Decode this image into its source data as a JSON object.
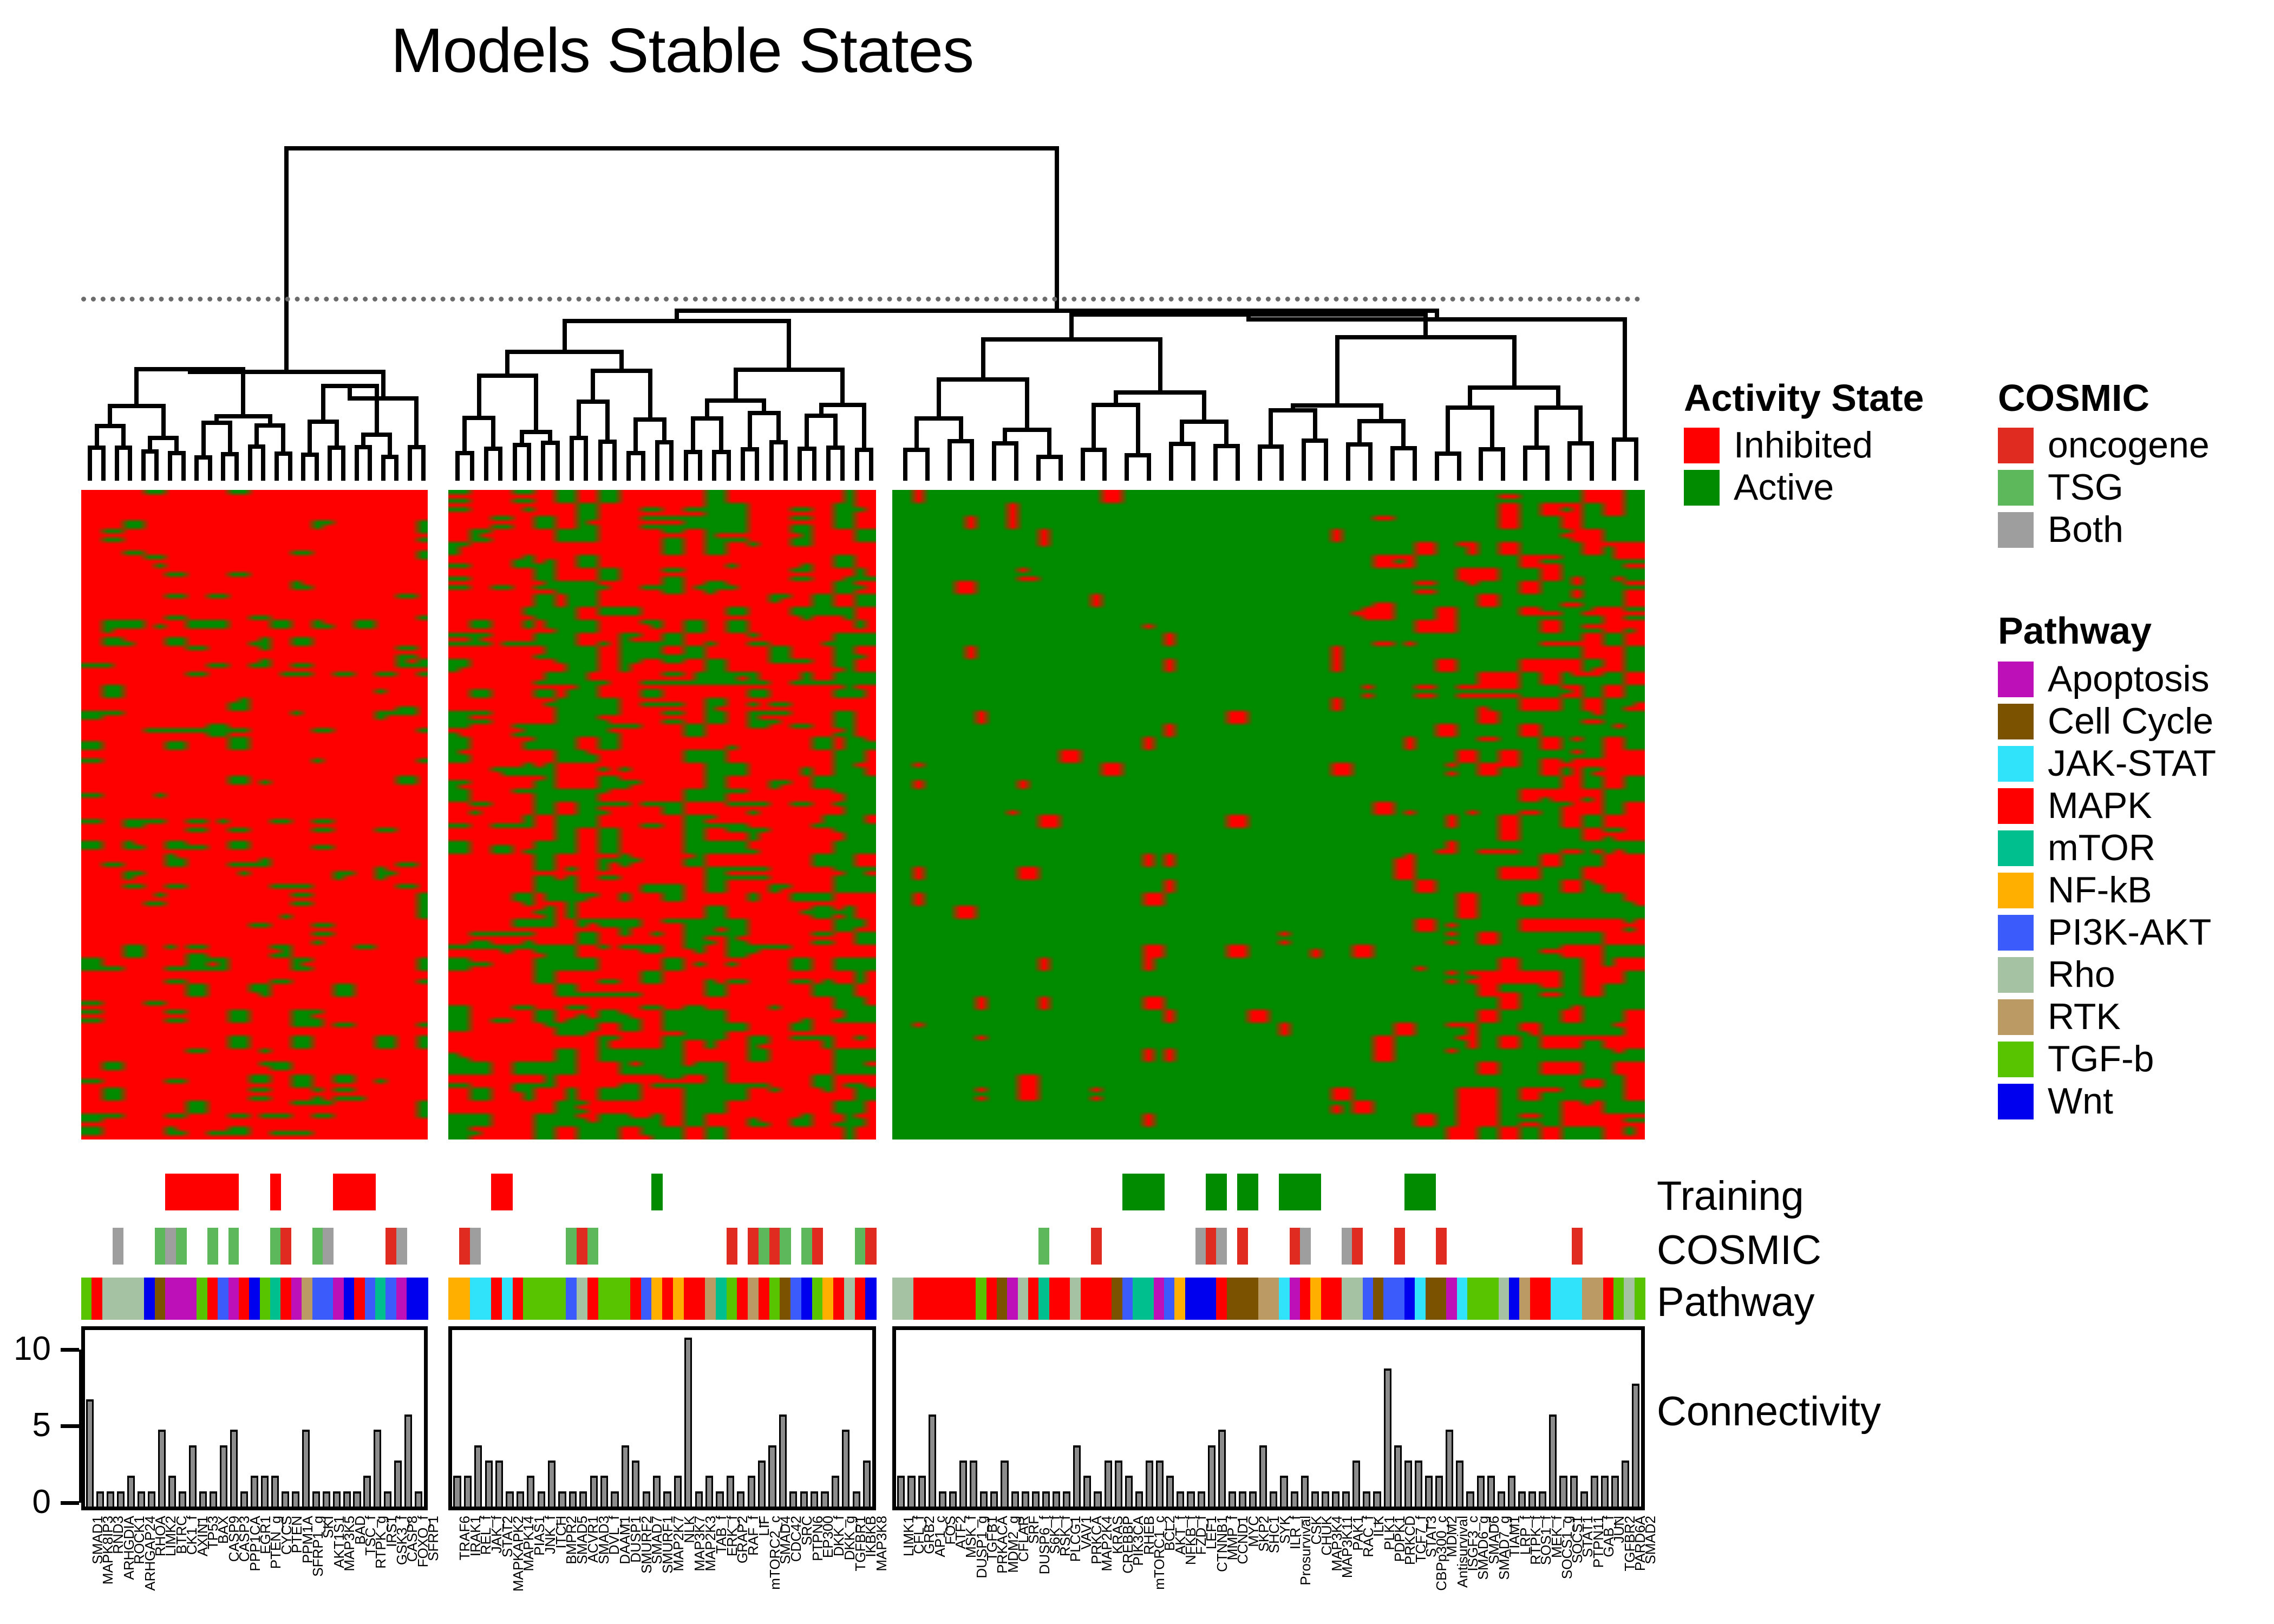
{
  "title": "Models Stable States",
  "row_titles": {
    "training": "Training",
    "cosmic": "COSMIC",
    "pathway": "Pathway",
    "connectivity": "Connectivity"
  },
  "legends": {
    "activity_state": {
      "title": "Activity State",
      "items": [
        {
          "label": "Inhibited",
          "color": "#FF0000"
        },
        {
          "label": "Active",
          "color": "#008B00"
        }
      ]
    },
    "cosmic": {
      "title": "COSMIC",
      "items": [
        {
          "label": "oncogene",
          "color": "#E02B20"
        },
        {
          "label": "TSG",
          "color": "#5DB85C"
        },
        {
          "label": "Both",
          "color": "#9E9E9E"
        }
      ]
    },
    "pathway": {
      "title": "Pathway",
      "items": [
        {
          "label": "Apoptosis",
          "color": "#BD10B8"
        },
        {
          "label": "Cell Cycle",
          "color": "#7A5200"
        },
        {
          "label": "JAK-STAT",
          "color": "#31E2FB"
        },
        {
          "label": "MAPK",
          "color": "#FF0000"
        },
        {
          "label": "mTOR",
          "color": "#00BF8F"
        },
        {
          "label": "NF-kB",
          "color": "#FFAF00"
        },
        {
          "label": "PI3K-AKT",
          "color": "#3B5BFB"
        },
        {
          "label": "Rho",
          "color": "#A5C3A2"
        },
        {
          "label": "RTK",
          "color": "#BC9A63"
        },
        {
          "label": "TGF-b",
          "color": "#58C400"
        },
        {
          "label": "Wnt",
          "color": "#0000EE"
        }
      ]
    }
  },
  "chart_data": {
    "type": "heatmap",
    "title": "Models Stable States",
    "description": "Clustered heatmap of boolean model stable states (Inhibited / Active) over network nodes, with column dendrogram, Training / COSMIC / Pathway annotation tracks and a Connectivity bar chart.",
    "value_encoding": {
      "Inhibited": "#FF0000",
      "Active": "#008B00"
    },
    "n_clusters": 3,
    "connectivity_axis": {
      "ylabel": "Connectivity",
      "ticks": [
        0,
        5,
        10
      ],
      "ylim": [
        0,
        11.5
      ]
    },
    "clusters": [
      {
        "name": "cluster-1",
        "dominant_state": "Inhibited",
        "genes": [
          "SMAD1",
          "MAPK8IP3",
          "RND3",
          "ARHGDIA",
          "ROCK1",
          "ARHGAP24",
          "RHOA",
          "LIMK2",
          "BTRC",
          "CK1_f",
          "AXIN1",
          "TP53",
          "BAX",
          "CASP9",
          "CASP3",
          "PPP1CA",
          "EGR1",
          "PTEN_g",
          "CYCS",
          "PTEN",
          "PPM1A",
          "SFRP1_g",
          "SKI",
          "AKT1S1",
          "MAP3K5",
          "BAD",
          "TSC_f",
          "RTPK_g",
          "IRS1",
          "GSK3_f",
          "CASP8",
          "FOXO_f",
          "SFRP1"
        ],
        "training": [
          0,
          0,
          0,
          0,
          0,
          0,
          0,
          0,
          1,
          1,
          1,
          1,
          1,
          1,
          1,
          0,
          0,
          0,
          1,
          0,
          0,
          0,
          0,
          0,
          1,
          1,
          1,
          1,
          0,
          0,
          0,
          0,
          0
        ],
        "cosmic": [
          "",
          "",
          "",
          "Both",
          "",
          "",
          "",
          "TSG",
          "Both",
          "TSG",
          "",
          "",
          "TSG",
          "",
          "TSG",
          "",
          "",
          "",
          "TSG",
          "oncogene",
          "",
          "",
          "TSG",
          "Both",
          "",
          "",
          "",
          "",
          "",
          "oncogene",
          "Both",
          "",
          ""
        ],
        "pathway": [
          "TGF-b",
          "MAPK",
          "Rho",
          "Rho",
          "Rho",
          "Rho",
          "Wnt",
          "Cell Cycle",
          "Apoptosis",
          "Apoptosis",
          "Apoptosis",
          "TGF-b",
          "MAPK",
          "PI3K-AKT",
          "Apoptosis",
          "MAPK",
          "Wnt",
          "TGF-b",
          "mTOR",
          "MAPK",
          "Apoptosis",
          "RTK",
          "PI3K-AKT",
          "PI3K-AKT",
          "Apoptosis",
          "Wnt",
          "MAPK",
          "PI3K-AKT",
          "mTOR",
          "PI3K-AKT",
          "Apoptosis",
          "Wnt",
          "Wnt"
        ],
        "connectivity": [
          7,
          1,
          1,
          1,
          2,
          1,
          1,
          5,
          2,
          1,
          4,
          1,
          1,
          4,
          5,
          1,
          2,
          2,
          2,
          1,
          1,
          5,
          1,
          1,
          1,
          1,
          1,
          2,
          5,
          1,
          3,
          6,
          1,
          3,
          1
        ]
      },
      {
        "name": "cluster-2",
        "dominant_state": "Mixed",
        "genes": [
          "TRAF6",
          "IRAK1",
          "REL_f",
          "JAK_f",
          "STAT2",
          "MAPKAPK2",
          "MAPK14",
          "PIAS1",
          "JNK_f",
          "ITCH",
          "BMPR2",
          "SMAD5",
          "ACVR1",
          "SMAD3",
          "DVL_f",
          "DAAM1",
          "DUSP1",
          "SMURF2",
          "SMAD7",
          "SMURF1",
          "MAP2K7",
          "NLK",
          "MAP3K7",
          "MAP2K3",
          "TAB_f",
          "ERK_f",
          "GRAP2",
          "RAF_f",
          "LIF",
          "mTORC2_c",
          "SMAD4",
          "CDC42",
          "SRC",
          "PTPN6",
          "EP300",
          "DKK_f",
          "DKK_g",
          "TGFBR1",
          "IKBKB",
          "MAP3K8"
        ],
        "training": [
          0,
          0,
          0,
          0,
          1,
          1,
          0,
          0,
          0,
          0,
          0,
          0,
          0,
          0,
          0,
          0,
          0,
          0,
          0,
          1,
          0,
          0,
          0,
          0,
          0,
          0,
          0,
          0,
          0,
          0,
          0,
          0,
          0,
          0,
          0,
          0,
          0,
          0,
          0,
          0
        ],
        "cosmic": [
          "",
          "oncogene",
          "Both",
          "",
          "",
          "",
          "",
          "",
          "",
          "",
          "",
          "TSG",
          "oncogene",
          "TSG",
          "",
          "",
          "",
          "",
          "",
          "",
          "",
          "",
          "",
          "",
          "",
          "",
          "oncogene",
          "",
          "oncogene",
          "TSG",
          "oncogene",
          "TSG",
          "",
          "TSG",
          "oncogene",
          "",
          "",
          "",
          "TSG",
          "oncogene"
        ],
        "pathway": [
          "NF-kB",
          "NF-kB",
          "JAK-STAT",
          "JAK-STAT",
          "MAPK",
          "JAK-STAT",
          "MAPK",
          "TGF-b",
          "TGF-b",
          "TGF-b",
          "TGF-b",
          "PI3K-AKT",
          "Rho",
          "MAPK",
          "TGF-b",
          "TGF-b",
          "TGF-b",
          "MAPK",
          "PI3K-AKT",
          "NF-kB",
          "MAPK",
          "NF-kB",
          "MAPK",
          "MAPK",
          "RTK",
          "mTOR",
          "TGF-b",
          "MAPK",
          "RTK",
          "MAPK",
          "TGF-b",
          "Cell Cycle",
          "PI3K-AKT",
          "Wnt",
          "TGF-b",
          "NF-kB",
          "MAPK",
          "Rho",
          "MAPK",
          "Wnt"
        ],
        "connectivity": [
          2,
          2,
          4,
          3,
          3,
          1,
          1,
          2,
          1,
          3,
          1,
          1,
          1,
          2,
          2,
          1,
          4,
          3,
          1,
          2,
          1,
          2,
          11,
          1,
          2,
          1,
          2,
          1,
          2,
          3,
          4,
          6,
          1,
          1,
          1,
          1,
          2,
          5,
          1,
          3,
          2,
          2,
          10,
          3,
          2,
          1,
          2,
          4,
          5,
          2,
          2,
          2,
          1,
          1,
          2,
          1,
          1,
          1
        ]
      },
      {
        "name": "cluster-3",
        "dominant_state": "Active",
        "genes": [
          "LIMK1",
          "CFL_f",
          "GRB2",
          "AP1_c",
          "FOS",
          "ATF2",
          "MSK_f",
          "DUSP1_g",
          "TGFB1",
          "PRKACA",
          "MDM2_g",
          "CFLAR",
          "SRF",
          "DUSP6_f",
          "S6K_f",
          "RSK_f",
          "PLCG1",
          "VAV1",
          "PRKCA",
          "MAP2K4",
          "KRAS",
          "CREBBP",
          "PIK3CA",
          "RHEB",
          "mTORC1_c",
          "BCL2",
          "AKT_f",
          "NFKB_f",
          "FZD_f",
          "LEF1",
          "CTNNB1",
          "MMP_f",
          "CCND1",
          "MYC",
          "SKP2",
          "SHC1",
          "SYK",
          "ILR_f",
          "Prosurvival",
          "CSK",
          "CHUK",
          "MAP3K4",
          "MAP3K11",
          "PAK1",
          "RAC_f",
          "ILK",
          "PLK1",
          "PDPK1",
          "PRKCD",
          "TCF7_f",
          "STAT3",
          "CBPp300_c",
          "MDM2",
          "Antisurvival",
          "ISGF3_c",
          "SMAD6_g",
          "SMAD6",
          "SMAD7_g",
          "TIAM1",
          "LRP_f",
          "RTPK_f",
          "SOS1_f",
          "MEK_f",
          "SOCS1_g",
          "SOCS1",
          "STAT1",
          "PTPN11",
          "GAB_f",
          "JUN",
          "TGFBR2",
          "PARD6A",
          "SMAD2"
        ],
        "training": [
          0,
          0,
          0,
          0,
          0,
          0,
          0,
          0,
          0,
          0,
          0,
          0,
          0,
          0,
          0,
          0,
          0,
          0,
          0,
          0,
          0,
          0,
          1,
          1,
          1,
          1,
          0,
          0,
          0,
          0,
          1,
          1,
          0,
          1,
          1,
          0,
          0,
          1,
          1,
          1,
          1,
          0,
          0,
          0,
          0,
          0,
          0,
          0,
          0,
          1,
          1,
          1,
          0,
          0,
          0,
          0,
          0,
          0,
          0,
          0,
          0,
          0,
          0,
          0,
          0,
          0,
          0,
          0,
          0,
          0,
          0,
          0
        ],
        "cosmic": [
          "",
          "",
          "",
          "",
          "",
          "",
          "",
          "",
          "",
          "",
          "",
          "",
          "",
          "",
          "TSG",
          "",
          "",
          "",
          "",
          "oncogene",
          "",
          "",
          "",
          "",
          "",
          "",
          "",
          "",
          "",
          "Both",
          "oncogene",
          "Both",
          "",
          "oncogene",
          "",
          "",
          "",
          "",
          "oncogene",
          "Both",
          "",
          "",
          "",
          "Both",
          "oncogene",
          "",
          "",
          "",
          "oncogene",
          "",
          "",
          "",
          "oncogene",
          "",
          "",
          "",
          "",
          "",
          "",
          "",
          "",
          "",
          "",
          "",
          "",
          "oncogene",
          "",
          "",
          "",
          "",
          "",
          ""
        ],
        "pathway": [
          "Rho",
          "Rho",
          "MAPK",
          "MAPK",
          "MAPK",
          "MAPK",
          "MAPK",
          "MAPK",
          "TGF-b",
          "MAPK",
          "Cell Cycle",
          "Apoptosis",
          "Rho",
          "MAPK",
          "mTOR",
          "MAPK",
          "MAPK",
          "Rho",
          "MAPK",
          "MAPK",
          "MAPK",
          "Cell Cycle",
          "PI3K-AKT",
          "mTOR",
          "mTOR",
          "Apoptosis",
          "PI3K-AKT",
          "NF-kB",
          "Wnt",
          "Wnt",
          "Wnt",
          "MAPK",
          "Cell Cycle",
          "Cell Cycle",
          "Cell Cycle",
          "RTK",
          "RTK",
          "JAK-STAT",
          "Apoptosis",
          "MAPK",
          "NF-kB",
          "MAPK",
          "MAPK",
          "Rho",
          "Rho",
          "PI3K-AKT",
          "Cell Cycle",
          "PI3K-AKT",
          "PI3K-AKT",
          "Wnt",
          "JAK-STAT",
          "Cell Cycle",
          "Cell Cycle",
          "Apoptosis",
          "JAK-STAT",
          "TGF-b",
          "TGF-b",
          "TGF-b",
          "Rho",
          "Wnt",
          "RTK",
          "MAPK",
          "MAPK",
          "JAK-STAT",
          "JAK-STAT",
          "JAK-STAT",
          "RTK",
          "RTK",
          "MAPK",
          "TGF-b",
          "Rho",
          "TGF-b"
        ],
        "connectivity": [
          2,
          2,
          2,
          6,
          1,
          1,
          3,
          3,
          1,
          1,
          3,
          1,
          1,
          1,
          1,
          1,
          1,
          4,
          2,
          1,
          3,
          3,
          2,
          1,
          3,
          3,
          2,
          1,
          1,
          1,
          4,
          5,
          1,
          1,
          1,
          4,
          1,
          2,
          1,
          2,
          1,
          1,
          1,
          1,
          3,
          1,
          1,
          9,
          4,
          3,
          3,
          2,
          2,
          5,
          3,
          1,
          2,
          2,
          1,
          2,
          1,
          1,
          1,
          6,
          2,
          2,
          1,
          2,
          2,
          2,
          3,
          8
        ]
      }
    ]
  }
}
